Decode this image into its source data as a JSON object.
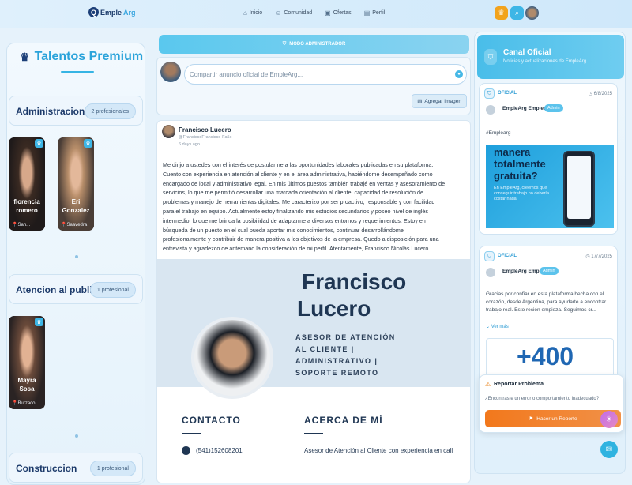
{
  "app": {
    "logo_text": "Emple",
    "logo_sub": "Arg"
  },
  "nav": [
    {
      "label": "Inicio",
      "icon": "home-icon"
    },
    {
      "label": "Comunidad",
      "icon": "people-icon"
    },
    {
      "label": "Ofertas",
      "icon": "briefcase-icon"
    },
    {
      "label": "Perfil",
      "icon": "document-icon"
    }
  ],
  "left": {
    "title": "Talentos Premium",
    "categories": [
      {
        "name": "Administracion",
        "count": "2 profesionales"
      },
      {
        "name": "Atencion al publico",
        "count": "1 profesional"
      },
      {
        "name": "Construccion",
        "count": "1 profesional"
      }
    ],
    "profiles": [
      {
        "name1": "florencia",
        "name2": "romero",
        "location": "San..."
      },
      {
        "name1": "Eri",
        "name2": "Gonzalez",
        "location": "Saavedra"
      },
      {
        "name1": "Mayra",
        "name2": "Sosa",
        "location": "Burzaco"
      }
    ]
  },
  "center": {
    "admin_banner": "MODO ADMINISTRADOR",
    "composer_placeholder": "Compartir anuncio oficial de EmpleArg...",
    "add_image": "Agregar Imagen",
    "post": {
      "author": "Francisco Lucero",
      "username": "@FranciscoFrancisco-Fa5x",
      "time": "6 days ago",
      "text": "Me dirijo a ustedes con el interés de postularme a las oportunidades laborales publicadas en su plataforma. Cuento con experiencia en atención al cliente y en el área administrativa, habiéndome desempeñado como encargado de local y administrativo legal. En mis últimos puestos también trabajé en ventas y asesoramiento de servicios, lo que me permitió desarrollar una marcada orientación al cliente, capacidad de resolución de problemas y manejo de herramientas digitales. Me caracterizo por ser proactivo, responsable y con facilidad para el trabajo en equipo. Actualmente estoy finalizando mis estudios secundarios y poseo nivel de inglés intermedio, lo que me brinda la posibilidad de adaptarme a diversos entornos y requerimientos. Estoy en búsqueda de un puesto en el cual pueda aportar mis conocimientos, continuar desarrollándome profesionalmente y contribuir de manera positiva a los objetivos de la empresa. Quedo a disposición para una entrevista y agradezco de antemano la consideración de mi perfil. Atentamente, Francisco Nicolás Lucero",
      "cv": {
        "first": "Francisco",
        "last": "Lucero",
        "role_lines": [
          "ASESOR DE ATENCIÓN",
          "AL CLIENTE |",
          "ADMINISTRATIVO |",
          "SOPORTE REMOTO"
        ],
        "contact_title": "CONTACTO",
        "about_title": "ACERCA DE MÍ",
        "phone": "(541)152608201",
        "about_text": "Asesor de Atención al Cliente con experiencia en call"
      }
    }
  },
  "right": {
    "title": "Canal Oficial",
    "subtitle": "Noticias y actualizaciones de EmpleArg",
    "posts": [
      {
        "badge": "OFICIAL",
        "date": "6/8/2025",
        "author": "EmpleArg Empleos",
        "role": "Admin",
        "hashtag": "#Emplearg",
        "ad_line1": "manera",
        "ad_line2": "totalmente",
        "ad_line3": "gratuita?",
        "ad_small": "En EmpleArg, creemos que conseguir trabajo no debería costar nada."
      },
      {
        "badge": "OFICIAL",
        "date": "17/7/2025",
        "author": "EmpleArg Empleos",
        "role": "Admin",
        "text": "Gracias por confiar en esta plataforma hecha con el corazón, desde Argentina, para ayudarte a encontrar trabajo real. Esto recién empieza. Seguimos cr...",
        "more": "Ver más",
        "big": "+400"
      }
    ],
    "report": {
      "title": "Reportar Problema",
      "question": "¿Encontraste un error o comportamiento inadecuado?",
      "button": "Hacer un Reporte"
    }
  },
  "colors": {
    "accent": "#3db6e6",
    "navy": "#1c3f78",
    "report": "#f2781c"
  }
}
